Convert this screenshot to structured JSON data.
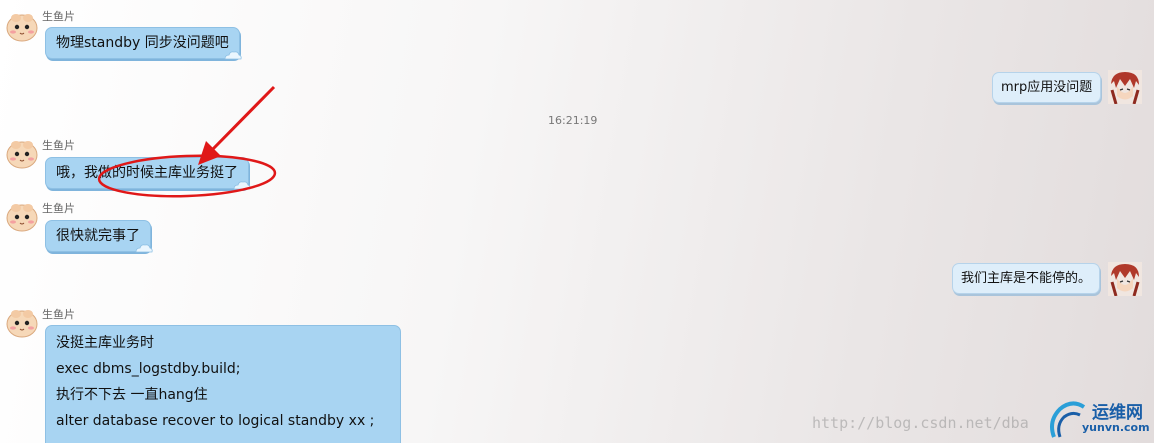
{
  "contact_name": "生鱼片",
  "timestamp": "16:21:19",
  "messages": [
    {
      "side": "left",
      "text": "物理standby 同步没问题吧"
    },
    {
      "side": "right",
      "text": "mrp应用没问题"
    },
    {
      "side": "left",
      "text": "哦，我做的时候主库业务挺了"
    },
    {
      "side": "left",
      "text": "很快就完事了"
    },
    {
      "side": "right",
      "text": "我们主库是不能停的。"
    },
    {
      "side": "left",
      "lines": [
        "没挺主库业务时",
        "exec dbms_logstdby.build;",
        "执行不下去 一直hang住",
        "alter  database recover to logical standby  xx ;"
      ]
    }
  ],
  "watermark": {
    "url": "http://blog.csdn.net/dba",
    "logo_cn": "运维网",
    "logo_en": "yunvn.com"
  },
  "colors": {
    "left_bubble": "#a8d4f2",
    "right_bubble": "#deeefa",
    "annotation": "#e01818",
    "logo": "#1a5fa8"
  },
  "icons": [
    "contact-avatar-icon",
    "self-avatar-icon",
    "bubble-cloud-icon",
    "red-arrow-annotation",
    "red-circle-annotation",
    "yunvn-logo-icon"
  ]
}
